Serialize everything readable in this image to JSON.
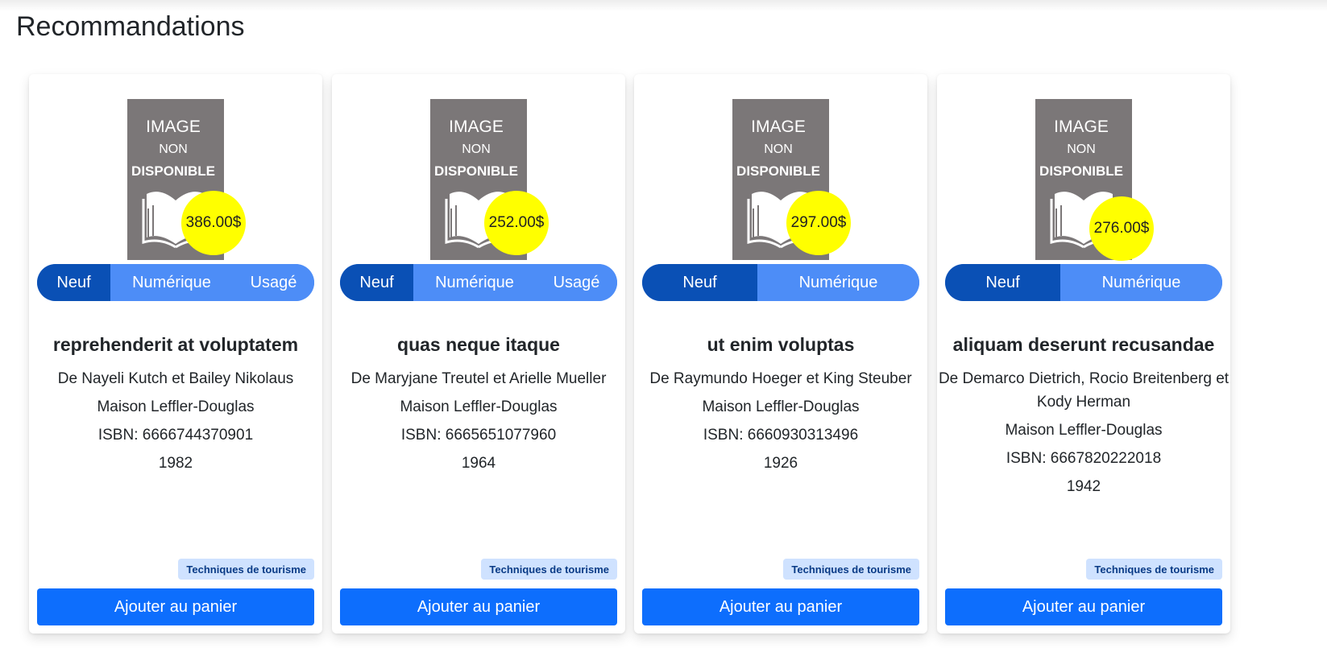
{
  "section": {
    "title": "Recommandations"
  },
  "placeholder": {
    "line1": "IMAGE",
    "line2": "NON",
    "line3": "DISPONIBLE"
  },
  "colors": {
    "price_badge": "#ffff00",
    "format_active": "#0a50b5",
    "format_inactive": "#4d8df7",
    "primary_button": "#0d6efd",
    "tag_bg": "#cfe2ff",
    "cover_gray": "#7b7778"
  },
  "books": [
    {
      "price": "386.00$",
      "formats": [
        "Neuf",
        "Numérique",
        "Usagé"
      ],
      "title": "reprehenderit at voluptatem",
      "authors": "De Nayeli Kutch et Bailey Nikolaus",
      "publisher": "Maison Leffler-Douglas",
      "isbn": "ISBN: 6666744370901",
      "year": "1982",
      "category": "Techniques de tourisme",
      "cart_label": "Ajouter au panier"
    },
    {
      "price": "252.00$",
      "formats": [
        "Neuf",
        "Numérique",
        "Usagé"
      ],
      "title": "quas neque itaque",
      "authors": "De Maryjane Treutel et Arielle Mueller",
      "publisher": "Maison Leffler-Douglas",
      "isbn": "ISBN: 6665651077960",
      "year": "1964",
      "category": "Techniques de tourisme",
      "cart_label": "Ajouter au panier"
    },
    {
      "price": "297.00$",
      "formats": [
        "Neuf",
        "Numérique"
      ],
      "title": "ut enim voluptas",
      "authors": "De Raymundo Hoeger et King Steuber",
      "publisher": "Maison Leffler-Douglas",
      "isbn": "ISBN: 6660930313496",
      "year": "1926",
      "category": "Techniques de tourisme",
      "cart_label": "Ajouter au panier"
    },
    {
      "price": "276.00$",
      "formats": [
        "Neuf",
        "Numérique"
      ],
      "title": "aliquam deserunt recusandae",
      "authors": "De Demarco Dietrich, Rocio Breitenberg et Kody Herman",
      "publisher": "Maison Leffler-Douglas",
      "isbn": "ISBN: 6667820222018",
      "year": "1942",
      "category": "Techniques de tourisme",
      "cart_label": "Ajouter au panier"
    }
  ]
}
